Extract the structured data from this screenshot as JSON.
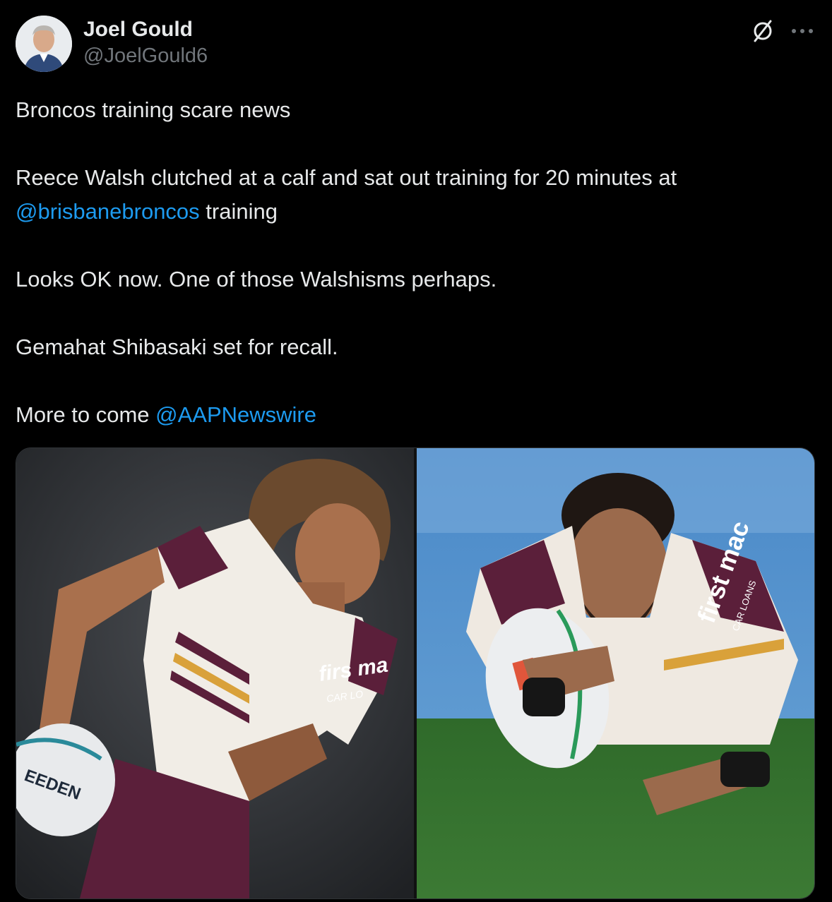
{
  "author": {
    "display_name": "Joel Gould",
    "handle": "@JoelGould6"
  },
  "icons": {
    "avatar": "avatar-photo",
    "grok": "grok-icon",
    "more": "more-icon"
  },
  "tweet": {
    "line1": "Broncos training scare news",
    "line2_pre": "Reece Walsh clutched at a calf and sat out training for 20 minutes at",
    "line2_mention": "@brisbanebroncos",
    "line2_post": " training",
    "line3": "Looks OK now. One of those Walshisms perhaps.",
    "line4": "Gemahat Shibasaki set for recall.",
    "line5_pre": "More to come ",
    "line5_mention": "@AAPNewswire"
  },
  "media": {
    "left_photo": {
      "jersey_sponsor_chest": "firs ma",
      "jersey_sponsor_sub": "CAR LO",
      "ball_text": "EEDEN"
    },
    "right_photo": {
      "jersey_sponsor_chest": "first mac",
      "jersey_sponsor_sub": "CAR LOANS"
    }
  },
  "colors": {
    "background": "#000000",
    "text": "#e7e9ea",
    "secondary": "#71767b",
    "link": "#1d9bf0",
    "maroon": "#5b1f3a",
    "gold": "#d9a13a"
  }
}
